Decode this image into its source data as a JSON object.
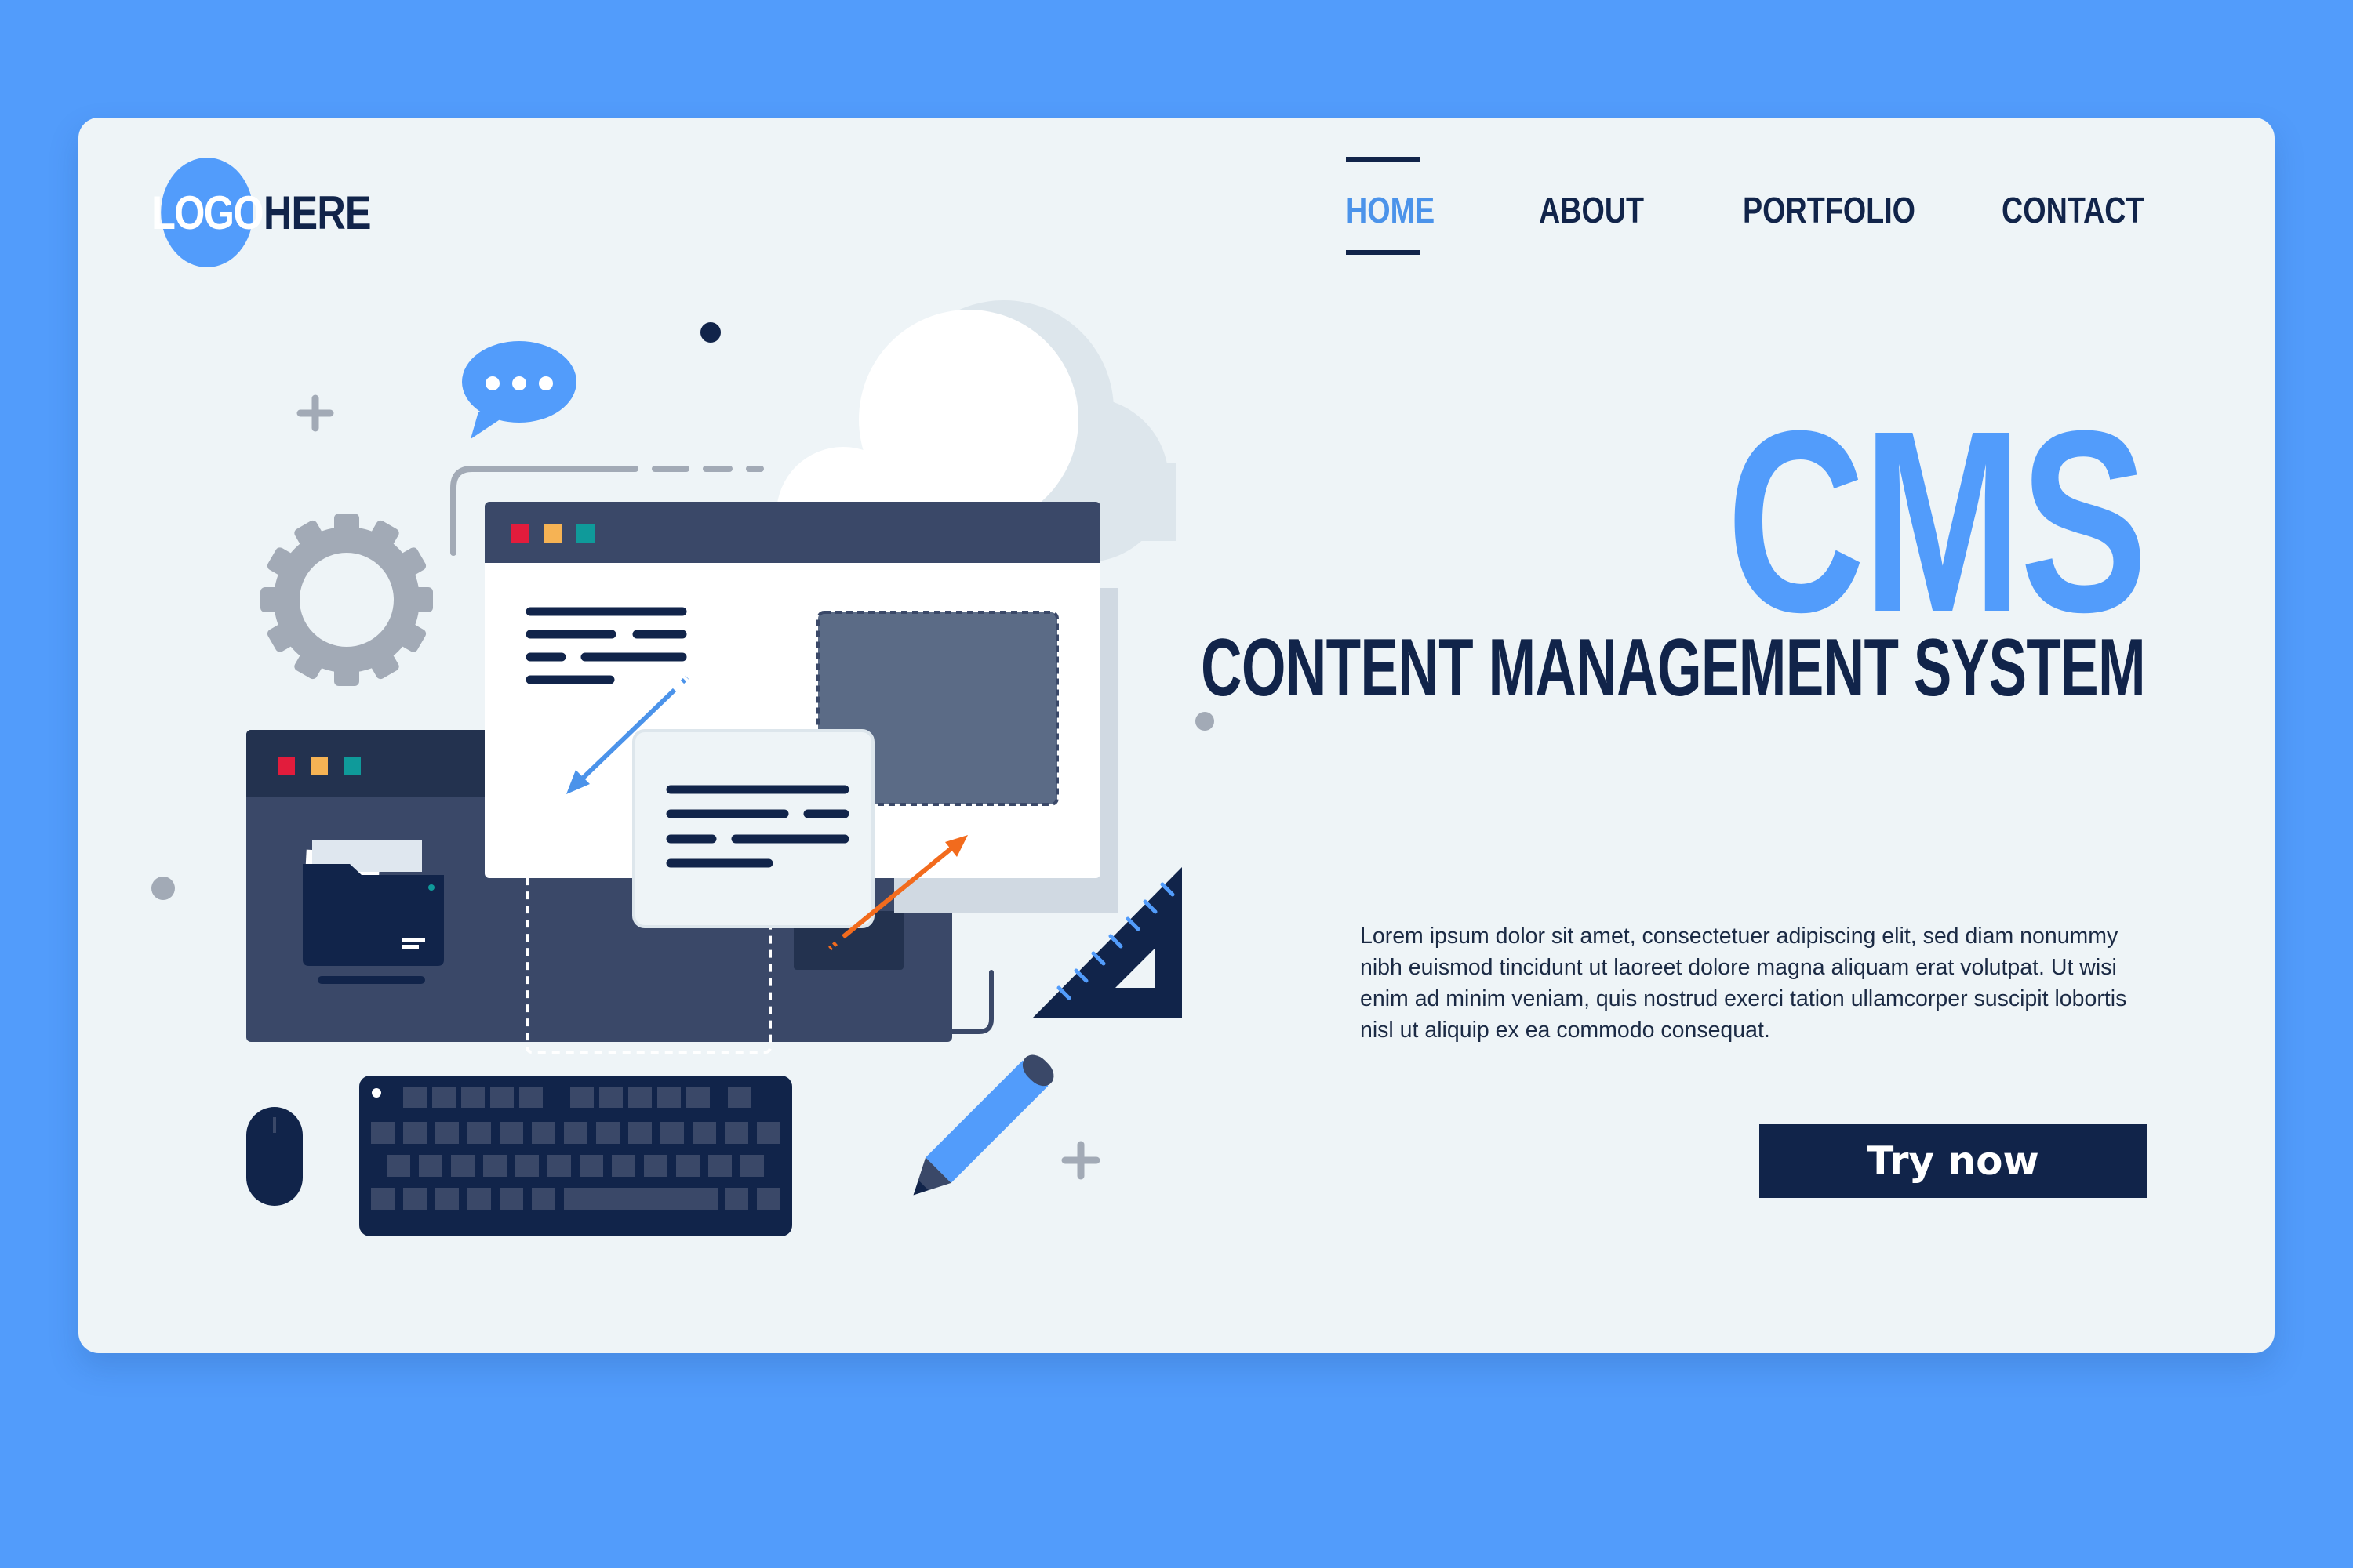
{
  "logo": {
    "circle_text": "LOGO",
    "text": "HERE"
  },
  "nav": {
    "items": [
      "HOME",
      "ABOUT",
      "PORTFOLIO",
      "CONTACT"
    ],
    "active": "HOME"
  },
  "hero": {
    "title": "CMS",
    "subtitle": "CONTENT MANAGEMENT SYSTEM",
    "body": "Lorem ipsum dolor sit amet, consectetuer adipiscing elit, sed diam nonummy nibh euismod tincidunt ut laoreet dolore magna aliquam erat volutpat. Ut wisi enim ad minim veniam, quis nostrud exerci tation ullamcorper suscipit lobortis nisl ut aliquip ex ea commodo consequat.",
    "cta_label": "Try now"
  },
  "colors": {
    "background": "#529cfb",
    "card": "#eef4f7",
    "accent": "#529cfb",
    "navy": "#11244a",
    "window_dots": [
      "#e21c3c",
      "#f6b354",
      "#0f9a9a"
    ]
  },
  "icons": [
    "chat-bubble-icon",
    "gear-icon",
    "cloud-icon",
    "plus-icon",
    "folder-icon",
    "keyboard-icon",
    "mouse-icon",
    "pencil-icon",
    "ruler-triangle-icon"
  ]
}
